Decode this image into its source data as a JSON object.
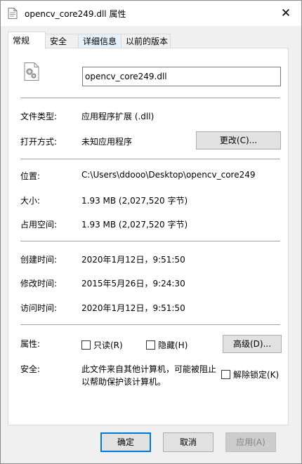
{
  "window": {
    "title": "opencv_core249.dll 属性",
    "close_glyph": "✕"
  },
  "tabs": [
    {
      "label": "常规",
      "active": true
    },
    {
      "label": "安全",
      "active": false
    },
    {
      "label": "详细信息",
      "active": false
    },
    {
      "label": "以前的版本",
      "active": false
    }
  ],
  "general": {
    "file_name": "opencv_core249.dll",
    "type_label": "文件类型:",
    "type_value": "应用程序扩展 (.dll)",
    "opens_with_label": "打开方式:",
    "opens_with_value": "未知应用程序",
    "change_button": "更改(C)...",
    "location_label": "位置:",
    "location_value": "C:\\Users\\ddooo\\Desktop\\opencv_core249",
    "size_label": "大小:",
    "size_value": "1.93 MB (2,027,520 字节)",
    "size_on_disk_label": "占用空间:",
    "size_on_disk_value": "1.93 MB (2,027,520 字节)",
    "created_label": "创建时间:",
    "created_value": "2020年1月12日，9:51:50",
    "modified_label": "修改时间:",
    "modified_value": "2015年5月26日，9:24:30",
    "accessed_label": "访问时间:",
    "accessed_value": "2020年1月12日，9:51:50",
    "attributes_label": "属性:",
    "readonly_label": "只读(R)",
    "hidden_label": "隐藏(H)",
    "advanced_button": "高级(D)...",
    "security_label": "安全:",
    "security_text_line1": "此文件来自其他计算机，可能被阻止",
    "security_text_line2": "以帮助保护该计算机。",
    "unblock_label": "解除锁定(K)"
  },
  "footer": {
    "ok_label": "确定",
    "cancel_label": "取消",
    "apply_label": "应用(A)"
  },
  "colors": {
    "default_button_border": "#0078d7",
    "tab_hover": "#e5f1fb"
  }
}
